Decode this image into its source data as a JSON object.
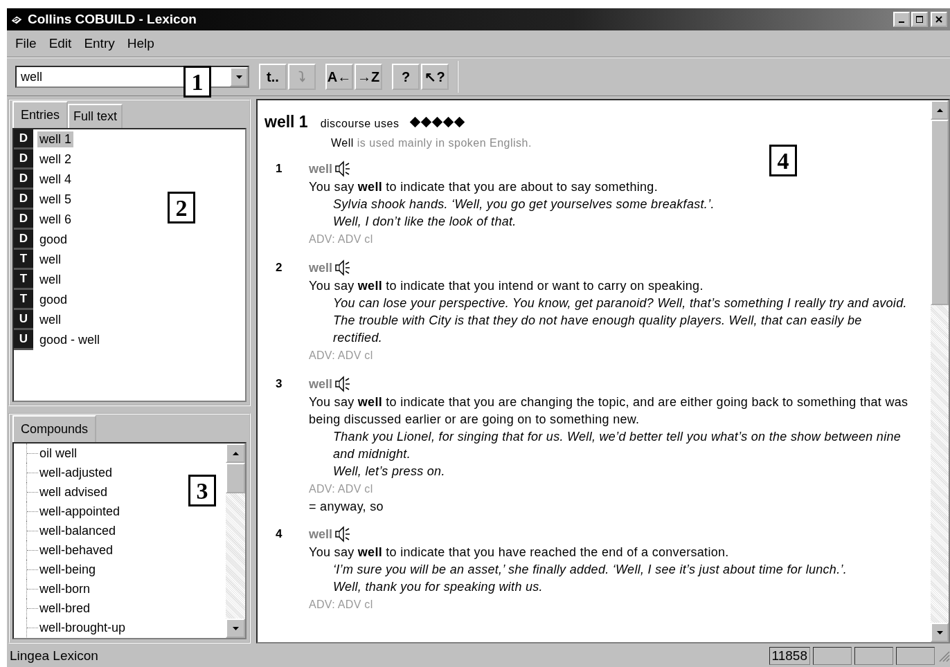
{
  "window": {
    "title": "Collins COBUILD - Lexicon"
  },
  "menu": [
    "File",
    "Edit",
    "Entry",
    "Help"
  ],
  "search": {
    "value": "well"
  },
  "toolbar": [
    {
      "label": "t..",
      "disabled": false
    },
    {
      "label": "⤵",
      "disabled": true
    },
    {
      "label": "A←",
      "disabled": false
    },
    {
      "label": "→Z",
      "disabled": false
    },
    {
      "label": "?",
      "disabled": false
    },
    {
      "label": "↖?",
      "disabled": false
    }
  ],
  "entry_tabs": [
    {
      "label": "Entries",
      "selected": true
    },
    {
      "label": "Full text",
      "selected": false
    }
  ],
  "entries": [
    {
      "kind": "D",
      "label": "well 1",
      "selected": true
    },
    {
      "kind": "D",
      "label": "well 2",
      "selected": false
    },
    {
      "kind": "D",
      "label": "well 4",
      "selected": false
    },
    {
      "kind": "D",
      "label": "well 5",
      "selected": false
    },
    {
      "kind": "D",
      "label": "well 6",
      "selected": false
    },
    {
      "kind": "D",
      "label": "good",
      "selected": false
    },
    {
      "kind": "T",
      "label": "well",
      "selected": false
    },
    {
      "kind": "T",
      "label": "well",
      "selected": false
    },
    {
      "kind": "T",
      "label": "good",
      "selected": false
    },
    {
      "kind": "U",
      "label": "well",
      "selected": false
    },
    {
      "kind": "U",
      "label": "good - well",
      "selected": false
    }
  ],
  "compounds_tab": {
    "label": "Compounds",
    "selected": true
  },
  "compounds": [
    "oil well",
    "well-adjusted",
    "well advised",
    "well-appointed",
    "well-balanced",
    "well-behaved",
    "well-being",
    "well-born",
    "well-bred",
    "well-brought-up"
  ],
  "entry": {
    "headword": "well 1",
    "label": "discourse uses",
    "stars": 5,
    "note": "**Well** is used mainly in spoken English.",
    "senses": [
      {
        "number": "1",
        "word": "well",
        "definition": "You say **well** to indicate that you are about to say something.",
        "examples": [
          "Sylvia shook hands. ‘Well, you go get yourselves some breakfast.’.",
          "Well, I don’t like the look of that."
        ],
        "grammar": "ADV: ADV cl"
      },
      {
        "number": "2",
        "word": "well",
        "definition": "You say **well** to indicate that you intend or want to carry on speaking.",
        "examples": [
          "You can lose your perspective. You know, get paranoid? Well, that’s something I really try and avoid.",
          "The trouble with City is that they do not have enough quality players. Well, that can easily be rectified."
        ],
        "grammar": "ADV: ADV cl"
      },
      {
        "number": "3",
        "word": "well",
        "definition": "You say **well** to indicate that you are changing the topic, and are either going back to something that was  being discussed earlier or are going on to something new.",
        "examples": [
          "Thank you Lionel, for singing that for us. Well, we’d better tell you what’s on the show between nine  and midnight.",
          "Well, let’s press on."
        ],
        "grammar": "ADV: ADV cl",
        "synonyms": "= anyway, so"
      },
      {
        "number": "4",
        "word": "well",
        "definition": "You say **well** to indicate that you have reached the end of a conversation.",
        "examples": [
          "‘I’m sure you will be an asset,’ she finally added. ‘Well, I see it’s just about time for lunch.’.",
          "Well, thank you for speaking with us."
        ],
        "grammar": "ADV: ADV cl"
      }
    ]
  },
  "status_bar": {
    "text": "Lingea Lexicon",
    "count": "11858"
  },
  "callouts": [
    "1",
    "2",
    "3",
    "4"
  ]
}
